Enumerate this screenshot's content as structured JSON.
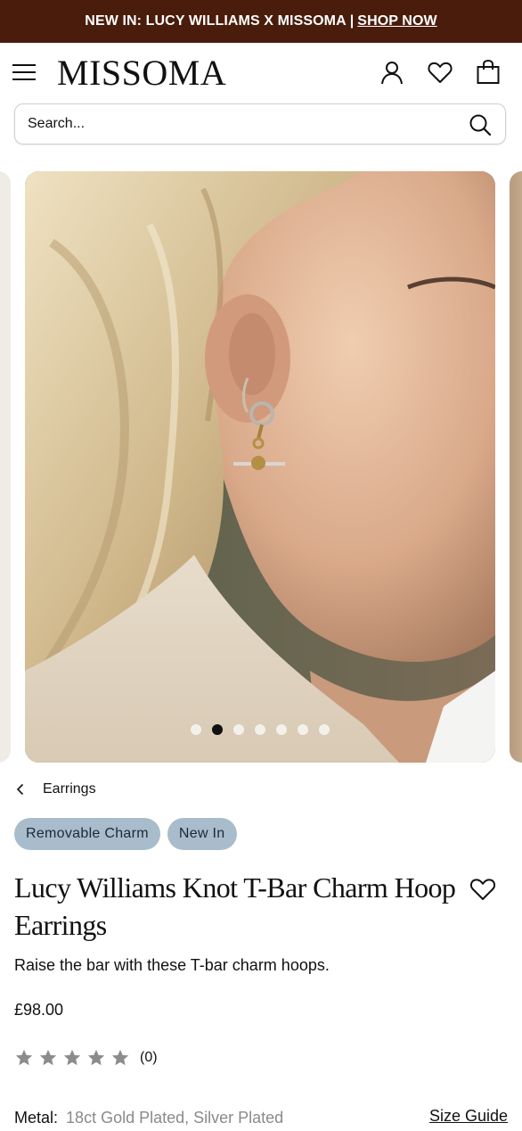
{
  "promo": {
    "text": "NEW IN: LUCY WILLIAMS X MISSOMA |",
    "link": "SHOP NOW"
  },
  "header": {
    "logo": "MISSOMA",
    "icons": [
      "menu-icon",
      "account-icon",
      "wishlist-icon",
      "bag-icon"
    ]
  },
  "search": {
    "placeholder": "Search..."
  },
  "carousel": {
    "total_slides": 7,
    "active_index": 1
  },
  "breadcrumb": {
    "label": "Earrings"
  },
  "tags": [
    "Removable Charm",
    "New In"
  ],
  "product": {
    "title": "Lucy Williams Knot T-Bar Charm Hoop Earrings",
    "description": "Raise the bar with these T-bar charm hoops.",
    "price": "£98.00",
    "rating": {
      "stars": 0,
      "max": 5,
      "count": "(0)"
    },
    "metal_label": "Metal:",
    "metal_value": "18ct Gold Plated, Silver Plated",
    "size_guide": "Size Guide"
  },
  "colors": {
    "promo_bg": "#4a1c0c",
    "tag_bg": "#a8bccb",
    "star": "#8c8c8c"
  }
}
